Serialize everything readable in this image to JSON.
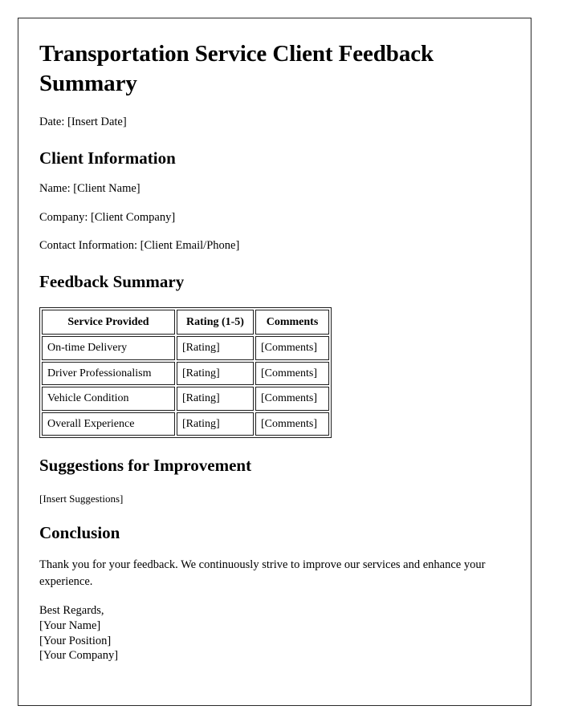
{
  "document": {
    "title": "Transportation Service Client Feedback Summary",
    "date_line": "Date: [Insert Date]"
  },
  "client_information": {
    "heading": "Client Information",
    "fields": [
      {
        "label": "Name:",
        "value": "[Client Name]",
        "line": "Name: [Client Name]"
      },
      {
        "label": "Company:",
        "value": "[Client Company]",
        "line": "Company: [Client Company]"
      },
      {
        "label": "Contact Information:",
        "value": "[Client Email/Phone]",
        "line": "Contact Information: [Client Email/Phone]"
      }
    ]
  },
  "feedback_summary": {
    "heading": "Feedback Summary",
    "table": {
      "columns": [
        "Service Provided",
        "Rating (1-5)",
        "Comments"
      ],
      "rows": [
        [
          "On-time Delivery",
          "[Rating]",
          "[Comments]"
        ],
        [
          "Driver Professionalism",
          "[Rating]",
          "[Comments]"
        ],
        [
          "Vehicle Condition",
          "[Rating]",
          "[Comments]"
        ],
        [
          "Overall Experience",
          "[Rating]",
          "[Comments]"
        ]
      ]
    }
  },
  "suggestions": {
    "heading": "Suggestions for Improvement",
    "placeholder": "[Insert Suggestions]"
  },
  "conclusion": {
    "heading": "Conclusion",
    "paragraph": "Thank you for your feedback. We continuously strive to improve our services and enhance your experience.",
    "signoff": {
      "closing": "Best Regards,",
      "name": "[Your Name]",
      "position": "[Your Position]",
      "company": "[Your Company]"
    }
  },
  "theme": {
    "page_background": "#ffffff",
    "text_color": "#000000",
    "border_color": "#2a2a2a",
    "table_border_color": "#1d1d1d"
  }
}
